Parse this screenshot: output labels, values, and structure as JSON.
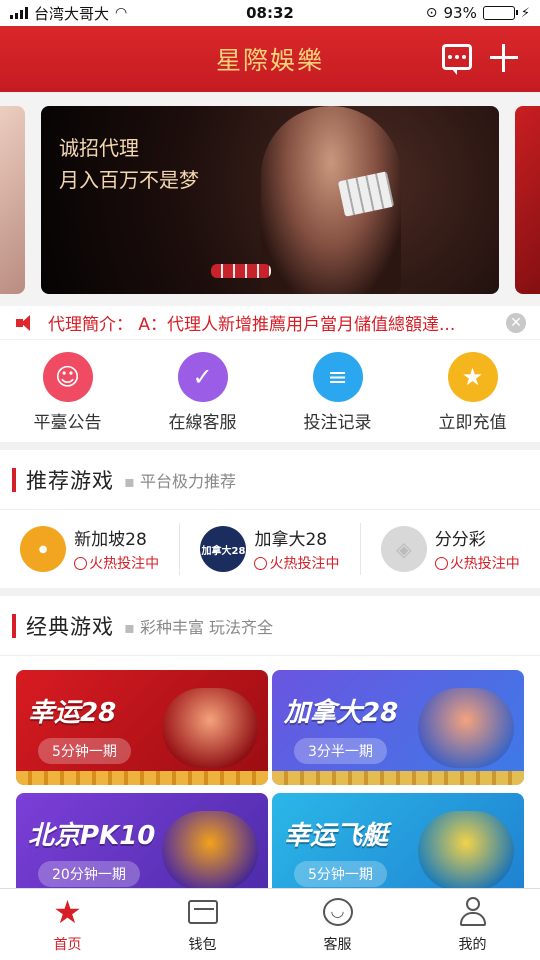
{
  "status": {
    "carrier": "台湾大哥大",
    "time": "08:32",
    "battery": "93%",
    "battery_level": 0.93
  },
  "header": {
    "title": "星際娛樂"
  },
  "banner": {
    "line1": "诚招代理",
    "line2": "月入百万不是梦",
    "slide_count": 3,
    "active_slide": 1
  },
  "notice": {
    "text": "代理簡介： A：代理人新增推薦用戶當月儲值總額達..."
  },
  "quick_actions": [
    {
      "label": "平臺公告",
      "icon": "smile-icon",
      "color": "#ef4c64"
    },
    {
      "label": "在線客服",
      "icon": "clipboard-check-icon",
      "color": "#9b5ce6"
    },
    {
      "label": "投注记录",
      "icon": "receipt-icon",
      "color": "#2aa7ee"
    },
    {
      "label": "立即充值",
      "icon": "star-icon",
      "color": "#f4b51d"
    }
  ],
  "recommended": {
    "title": "推荐游戏",
    "subtitle": "平台极力推荐",
    "games": [
      {
        "name": "新加坡28",
        "status": "火热投注中",
        "logo_color": "#f2a51f"
      },
      {
        "name": "加拿大28",
        "status": "火热投注中",
        "logo_color": "#1b2c5f",
        "logo_text": "加拿大28"
      },
      {
        "name": "分分彩",
        "status": "火热投注中",
        "logo_color": "#d8d8d8"
      }
    ]
  },
  "classic": {
    "title": "经典游戏",
    "subtitle": "彩种丰富 玩法齐全",
    "games": [
      {
        "name": "幸运28",
        "period": "5分钟一期",
        "bg_from": "#d81b22",
        "bg_to": "#9a0d12",
        "art": "#f4a37c"
      },
      {
        "name": "加拿大28",
        "period": "3分半一期",
        "bg_from": "#6a55e0",
        "bg_to": "#3d7be8",
        "art": "#f4a37c"
      },
      {
        "name": "北京PK10",
        "period": "20分钟一期",
        "bg_from": "#7c3fd8",
        "bg_to": "#4b2ba8",
        "art": "#f2a21a"
      },
      {
        "name": "幸运飞艇",
        "period": "5分钟一期",
        "bg_from": "#2bb7e8",
        "bg_to": "#1f7fd0",
        "art": "#f2d24a"
      }
    ]
  },
  "tabbar": [
    {
      "label": "首页",
      "icon": "star-icon",
      "active": true
    },
    {
      "label": "钱包",
      "icon": "wallet-icon",
      "active": false
    },
    {
      "label": "客服",
      "icon": "chat-bubble-icon",
      "active": false
    },
    {
      "label": "我的",
      "icon": "user-icon",
      "active": false
    }
  ]
}
